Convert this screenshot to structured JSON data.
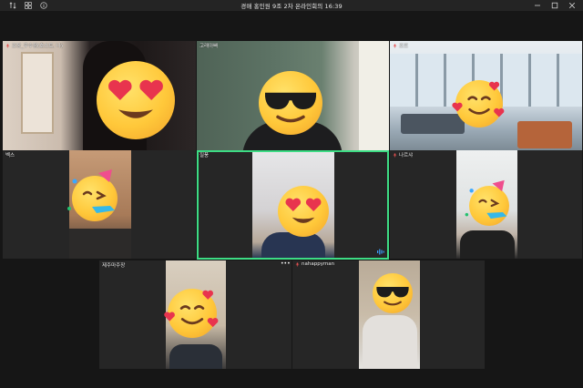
{
  "window": {
    "title": "경매 홍인원 9조 2차 온라인회의 16:39"
  },
  "participants": [
    {
      "name": "조장_우수정(호스트, 나)",
      "emoji": "heart-eyes-emoji"
    },
    {
      "name": "고래아빠",
      "emoji": "sunglasses-emoji"
    },
    {
      "name": "조르",
      "emoji": "smiling-hearts-emoji"
    },
    {
      "name": "벡스",
      "emoji": "party-emoji"
    },
    {
      "name": "질풍",
      "emoji": "heart-eyes-emoji",
      "speaking": true
    },
    {
      "name": "나르샤",
      "emoji": "party-emoji"
    },
    {
      "name": "제주마주장",
      "emoji": "smiling-hearts-emoji"
    },
    {
      "name": "nahappyman",
      "emoji": "sunglasses-emoji"
    }
  ],
  "colors": {
    "active_speaker_border": "#3ddc84",
    "mic_icon": "#e35050"
  }
}
